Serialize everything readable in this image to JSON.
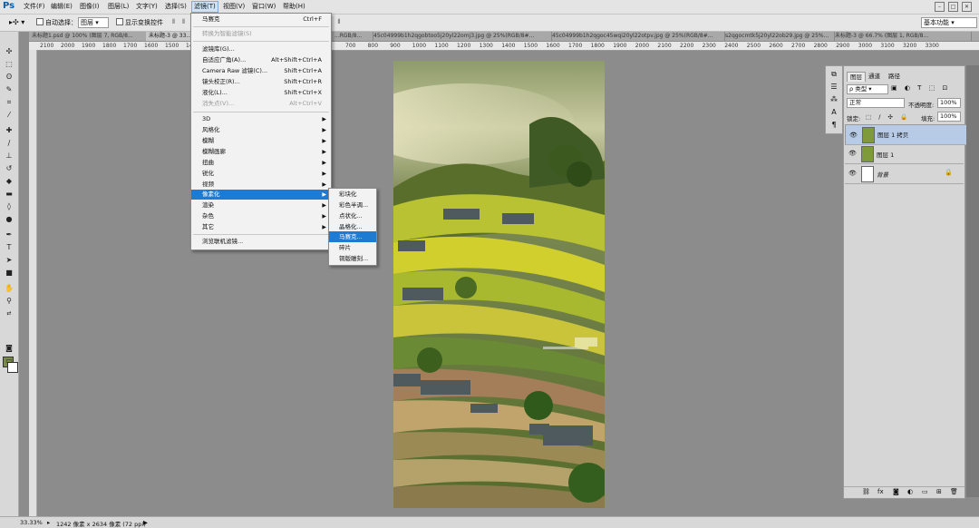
{
  "app": {
    "logo": "Ps"
  },
  "menubar": {
    "items": [
      "文件(F)",
      "编辑(E)",
      "图像(I)",
      "图层(L)",
      "文字(Y)",
      "选择(S)",
      "滤镜(T)",
      "视图(V)",
      "窗口(W)",
      "帮助(H)"
    ],
    "active_index": 6
  },
  "options": {
    "auto_select_label": "自动选择：",
    "auto_select_target": "图层",
    "show_transform_label": "显示变换控件",
    "workspace": "基本功能"
  },
  "tabs": [
    "未标题1.psd @ 100% (图层 7, RGB/8...",
    "未标题-3 @ 33...",
    "...RGB/8...",
    "45c04999b1h2qgobtoo5j20yl22omj3.jpg @ 25%(RGB/8#...",
    "45c04999b1h2qgoc45wqi20yl22otpv.jpg @ 25%(RGB/8#...",
    "s2qgocmtk5j20yl22ob29.jpg @ 25%...",
    "未标题-3 @ 66.7% (图层 1, RGB/8..."
  ],
  "ruler": {
    "left_ticks": [
      "2100",
      "2000",
      "1900",
      "1800",
      "1700",
      "1600",
      "1500",
      "1400",
      "1300"
    ],
    "right_ticks": [
      "700",
      "800",
      "900",
      "1000",
      "1100",
      "1200",
      "1300",
      "1400",
      "1500",
      "1600",
      "1700",
      "1800",
      "1900",
      "2000",
      "2100",
      "2200",
      "2300",
      "2400",
      "2500",
      "2600",
      "2700",
      "2800",
      "2900",
      "3000",
      "3100",
      "3200",
      "3300"
    ]
  },
  "filter_menu": {
    "last_filter": {
      "label": "马赛克",
      "shortcut": "Ctrl+F"
    },
    "convert_smart": "转换为智能滤镜(S)",
    "group1": [
      {
        "label": "滤镜库(G)...",
        "shortcut": ""
      },
      {
        "label": "自适应广角(A)...",
        "shortcut": "Alt+Shift+Ctrl+A"
      },
      {
        "label": "Camera Raw 滤镜(C)...",
        "shortcut": "Shift+Ctrl+A"
      },
      {
        "label": "镜头校正(R)...",
        "shortcut": "Shift+Ctrl+R"
      },
      {
        "label": "液化(L)...",
        "shortcut": "Shift+Ctrl+X"
      },
      {
        "label": "消失点(V)...",
        "shortcut": "Alt+Ctrl+V"
      }
    ],
    "submenus": [
      "3D",
      "风格化",
      "模糊",
      "模糊画廊",
      "扭曲",
      "锐化",
      "视频",
      "像素化",
      "渲染",
      "杂色",
      "其它"
    ],
    "highlighted_submenu": "像素化",
    "browse_online": "浏览联机滤镜..."
  },
  "pixelate_submenu": {
    "items": [
      "彩块化",
      "彩色半调...",
      "点状化...",
      "晶格化...",
      "马赛克...",
      "碎片",
      "铜版雕刻..."
    ],
    "highlighted": "马赛克..."
  },
  "layers_panel": {
    "tabs": [
      "图层",
      "通道",
      "路径"
    ],
    "filter_kind": "ρ 类型",
    "blend_mode": "正常",
    "opacity_label": "不透明度:",
    "opacity_value": "100%",
    "lock_label": "锁定:",
    "fill_label": "填充:",
    "fill_value": "100%",
    "layers": [
      {
        "name": "图层 1 拷贝",
        "selected": true
      },
      {
        "name": "图层 1",
        "selected": false
      },
      {
        "name": "背景",
        "selected": false,
        "locked": true
      }
    ]
  },
  "status": {
    "zoom": "33.33%",
    "doc_info": "1242 像素 x 2634 像素 (72 ppi)"
  },
  "colors": {
    "menu_highlight": "#1e7bd4",
    "layer_selected": "#b7cbe6",
    "foreground": "#7a8c4a",
    "background": "#ffffff"
  }
}
